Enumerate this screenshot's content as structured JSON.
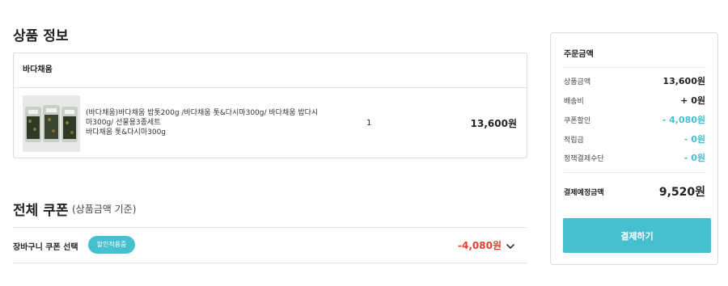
{
  "product_section": {
    "title": "상품 정보",
    "brand": "바다채움",
    "item": {
      "name_lines": [
        "(바다채움)바다채움 밥톳200g /바다채움 톳&다시마300g/ 바다채움 밥다시",
        "마300g/ 선물용3종세트",
        "바다채움 톳&다시마300g"
      ],
      "quantity": "1",
      "price": "13,600원"
    }
  },
  "coupon_section": {
    "title": "전체 쿠폰",
    "subtitle": "(상품금액 기준)",
    "select_label": "장바구니 쿠폰 선택",
    "badge": "할인적용중",
    "amount": "-4,080원",
    "colors": {
      "badge": "#46bfcf",
      "amount": "#e8402e"
    }
  },
  "summary": {
    "title": "주문금액",
    "rows": [
      {
        "label": "상품금액",
        "value": "13,600원"
      },
      {
        "label": "배송비",
        "value": "+ 0원"
      },
      {
        "label": "쿠폰할인",
        "value": "- 4,080원"
      },
      {
        "label": "적립금",
        "value": "- 0원"
      },
      {
        "label": "정책결제수단",
        "value": "- 0원"
      }
    ],
    "total_label": "결제예정금액",
    "total_value": "9,520원",
    "pay_button": "결제하기",
    "colors": {
      "accent": "#46bfcf"
    }
  },
  "icons": {
    "coupon_toggle": "chevron-down-icon",
    "product_image": "seaweed-gift-set-image"
  }
}
